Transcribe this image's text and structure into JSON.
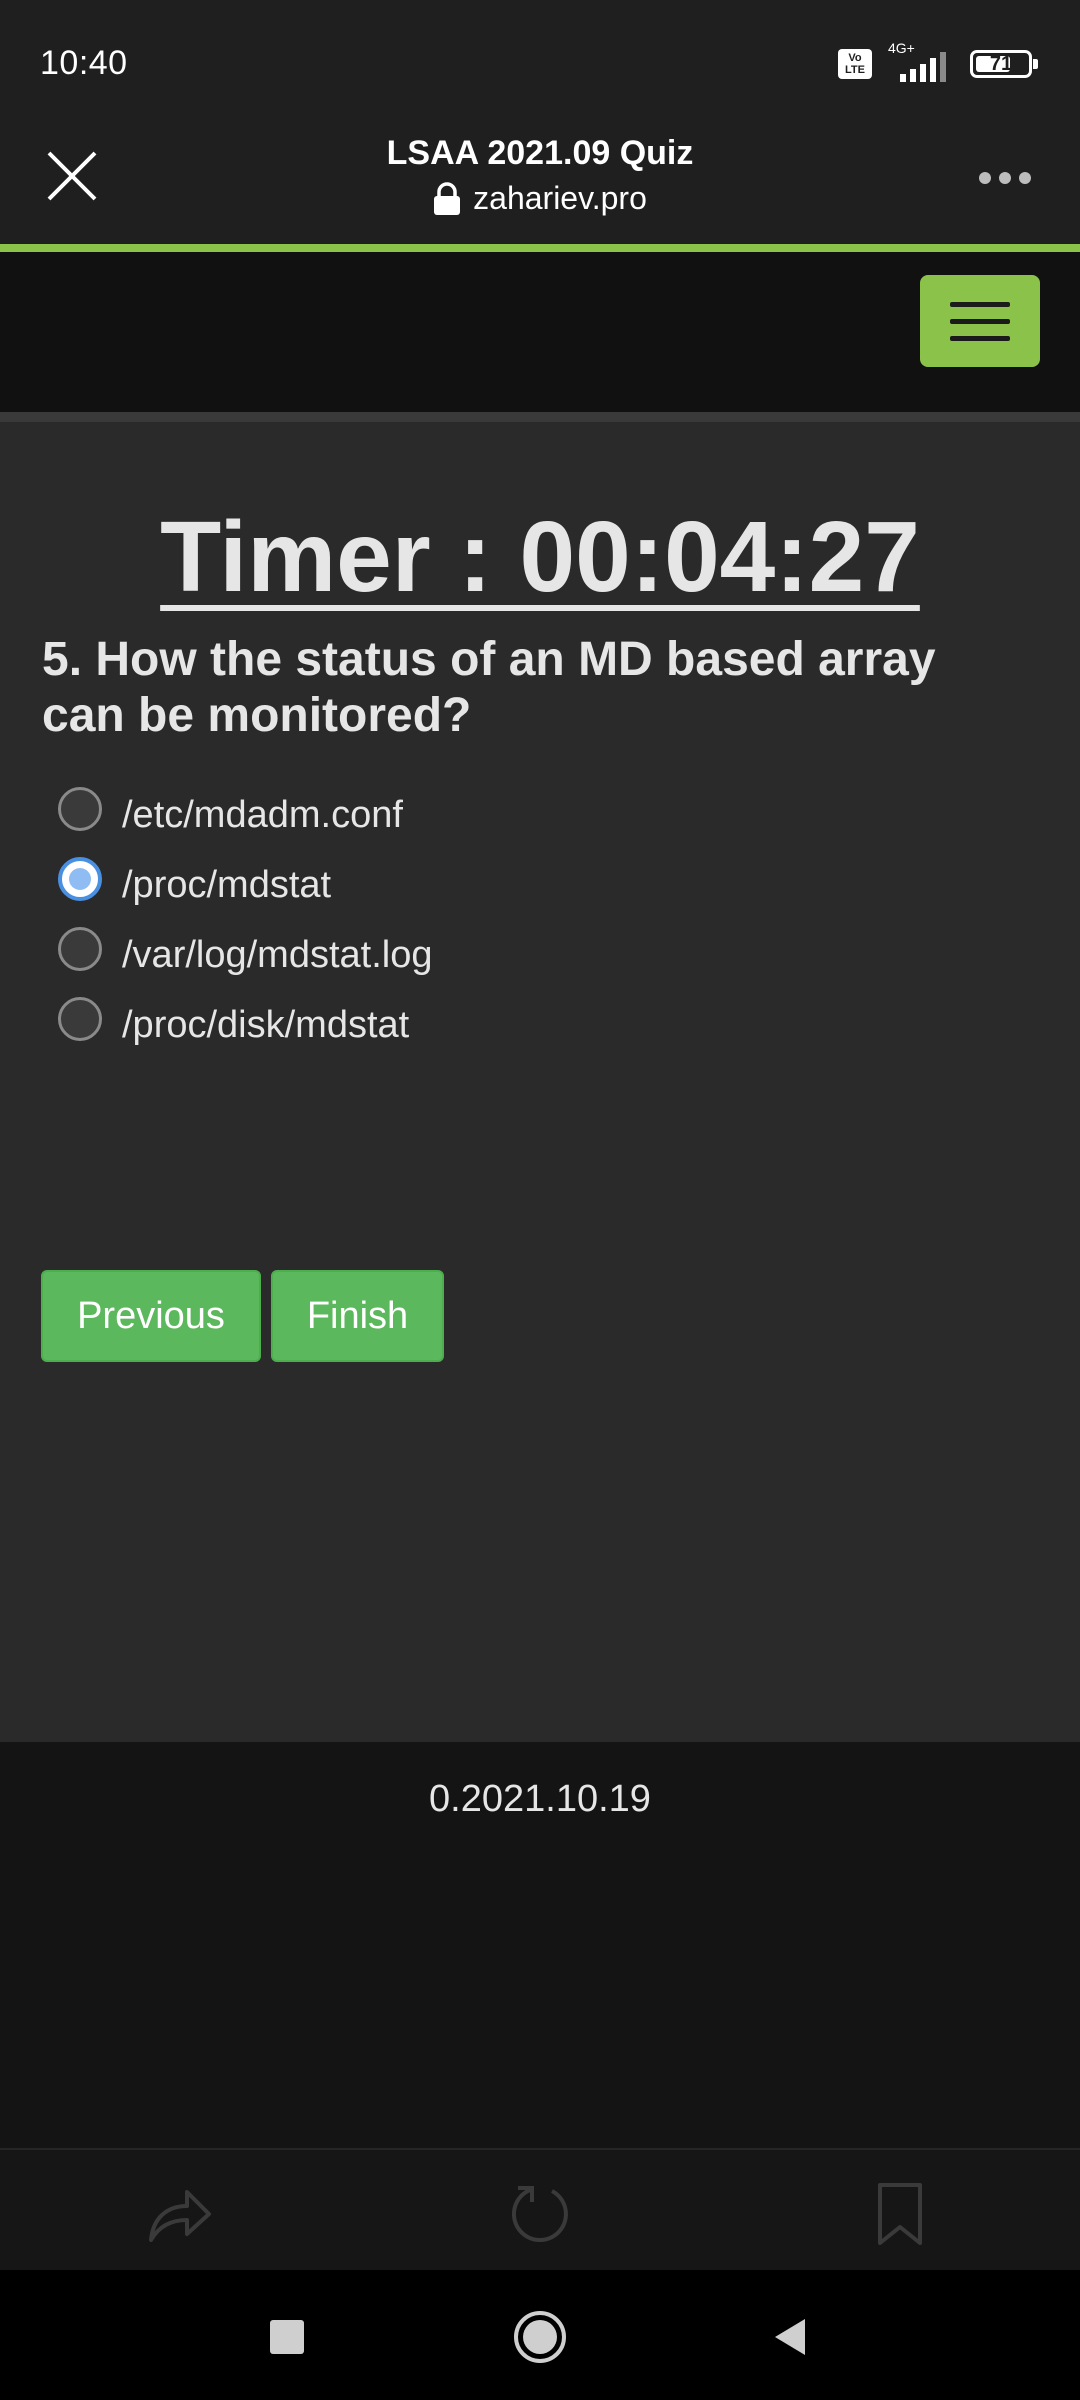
{
  "status_bar": {
    "time": "10:40",
    "volte_top": "Vo",
    "volte_bottom": "LTE",
    "network": "4G+",
    "battery_percent": "71"
  },
  "browser": {
    "page_title": "LSAA 2021.09 Quiz",
    "domain": "zahariev.pro",
    "accent_color": "#8bc34a"
  },
  "quiz": {
    "timer": "Timer : 00:04:27",
    "question": "5. How the status of an MD based array can be monitored?",
    "options": [
      {
        "label": "/etc/mdadm.conf",
        "selected": false
      },
      {
        "label": "/proc/mdstat",
        "selected": true
      },
      {
        "label": "/var/log/mdstat.log",
        "selected": false
      },
      {
        "label": "/proc/disk/mdstat",
        "selected": false
      }
    ],
    "previous_label": "Previous",
    "finish_label": "Finish",
    "button_color": "#5cb85c"
  },
  "footer": {
    "version": "0.2021.10.19"
  },
  "icons": {
    "close": "close-icon",
    "lock": "lock-icon",
    "more": "more-icon",
    "menu": "hamburger-menu-icon",
    "share": "share-icon",
    "reload": "reload-icon",
    "bookmark": "bookmark-icon",
    "recents": "recents-icon",
    "home": "home-icon",
    "back": "back-icon"
  }
}
